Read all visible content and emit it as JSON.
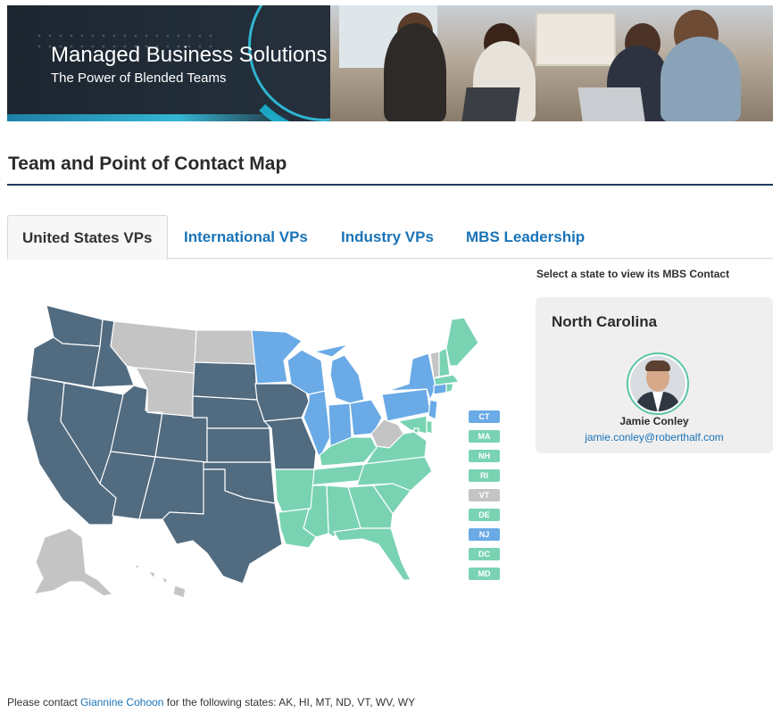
{
  "banner": {
    "title": "Managed Business Solutions",
    "subtitle": "The Power of Blended Teams"
  },
  "page": {
    "title": "Team and Point of Contact Map"
  },
  "tabs": [
    {
      "label": "United States VPs",
      "active": true
    },
    {
      "label": "International VPs",
      "active": false
    },
    {
      "label": "Industry VPs",
      "active": false
    },
    {
      "label": "MBS Leadership",
      "active": false
    }
  ],
  "colors": {
    "dark_region": "#516b80",
    "blue_region": "#6aaae6",
    "green_region": "#79d3b2",
    "unassigned": "#c4c4c4",
    "link": "#1a74b8"
  },
  "map": {
    "regions": {
      "dark": [
        "WA",
        "OR",
        "CA",
        "NV",
        "ID",
        "UT",
        "AZ",
        "CO",
        "NM",
        "TX",
        "OK",
        "KS",
        "NE",
        "SD",
        "IA",
        "MO"
      ],
      "blue": [
        "MN",
        "WI",
        "IL",
        "IN",
        "MI",
        "OH",
        "PA",
        "NY",
        "NJ",
        "CT"
      ],
      "green": [
        "ME",
        "NH",
        "MA",
        "RI",
        "DE",
        "MD",
        "DC",
        "VA",
        "KY",
        "TN",
        "NC",
        "SC",
        "GA",
        "FL",
        "AL",
        "MS",
        "LA",
        "AR"
      ],
      "grey": [
        "MT",
        "WY",
        "ND",
        "AK",
        "HI",
        "VT",
        "WV"
      ]
    },
    "small_state_badges": [
      {
        "abbr": "CT",
        "region": "blue"
      },
      {
        "abbr": "MA",
        "region": "green"
      },
      {
        "abbr": "NH",
        "region": "green"
      },
      {
        "abbr": "RI",
        "region": "green"
      },
      {
        "abbr": "VT",
        "region": "grey"
      },
      {
        "abbr": "DE",
        "region": "green"
      },
      {
        "abbr": "NJ",
        "region": "blue"
      },
      {
        "abbr": "DC",
        "region": "green"
      },
      {
        "abbr": "MD",
        "region": "green"
      }
    ]
  },
  "contact_panel": {
    "hint": "Select a state to view its MBS Contact",
    "state_name": "North Carolina",
    "person_name": "Jamie Conley",
    "email": "jamie.conley@roberthalf.com"
  },
  "footer": {
    "prefix": "Please contact ",
    "link_text": "Giannine Cohoon",
    "suffix": " for the following states: AK, HI, MT, ND, VT, WV, WY"
  }
}
